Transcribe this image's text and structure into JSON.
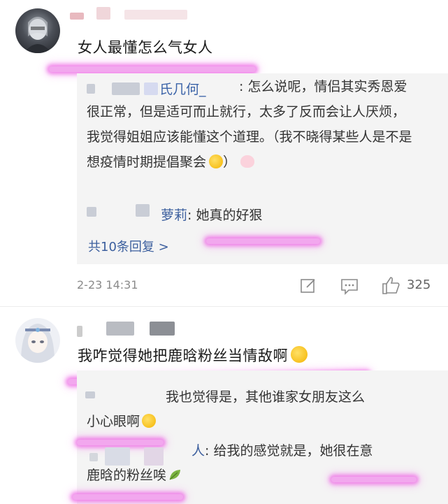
{
  "comment1": {
    "text": "女人最懂怎么气女人",
    "replies": [
      {
        "name_fragment": "氏几何_",
        "text": ": 怎么说呢，情侣其实秀恩爱很正常，但是适可而止就行，太多了反而会让人厌烦，我觉得姐姐应该能懂这个道理。（我不晓得某些人是不是想疫情时期提倡聚会"
      },
      {
        "name_fragment": "萝莉",
        "text": ": 她真的好狠"
      }
    ],
    "more_replies": "共10条回复 >",
    "timestamp": "2-23 14:31",
    "likes": "325"
  },
  "comment2": {
    "text": "我咋觉得她把鹿晗粉丝当情敌啊",
    "replies": [
      {
        "text_line1": "我也觉得是，其他谁家女朋友这么",
        "text_line2": "小心眼啊"
      },
      {
        "name_fragment": "人",
        "text_line1": ": 给我的感觉就是，她很在意",
        "text_line2": "鹿晗的粉丝唉"
      }
    ]
  },
  "icons": [
    "edit-icon",
    "comment-icon",
    "thumbs-up-icon",
    "laugh-emoji-icon",
    "pig-emoji-icon",
    "leaf-emoji-icon",
    "yum-emoji-icon"
  ],
  "colors": {
    "highlight": "#f2a7ee",
    "name_link": "#3c5f9e",
    "reply_bg": "#f4f4f4"
  }
}
